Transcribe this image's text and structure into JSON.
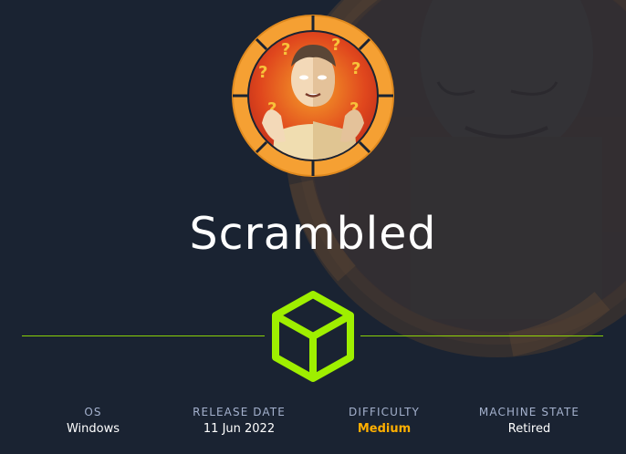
{
  "machine": {
    "name": "Scrambled"
  },
  "colors": {
    "background": "#1a2332",
    "accent_green": "#9fef00",
    "difficulty_medium": "#ffaf00",
    "avatar_ring": "#f5a033",
    "label_gray": "#a4b1cd"
  },
  "icons": {
    "avatar": "machine-avatar",
    "cube": "hackthebox-cube-icon"
  },
  "stats": [
    {
      "label": "OS",
      "value": "Windows"
    },
    {
      "label": "RELEASE DATE",
      "value": "11 Jun 2022"
    },
    {
      "label": "DIFFICULTY",
      "value": "Medium"
    },
    {
      "label": "MACHINE STATE",
      "value": "Retired"
    }
  ]
}
